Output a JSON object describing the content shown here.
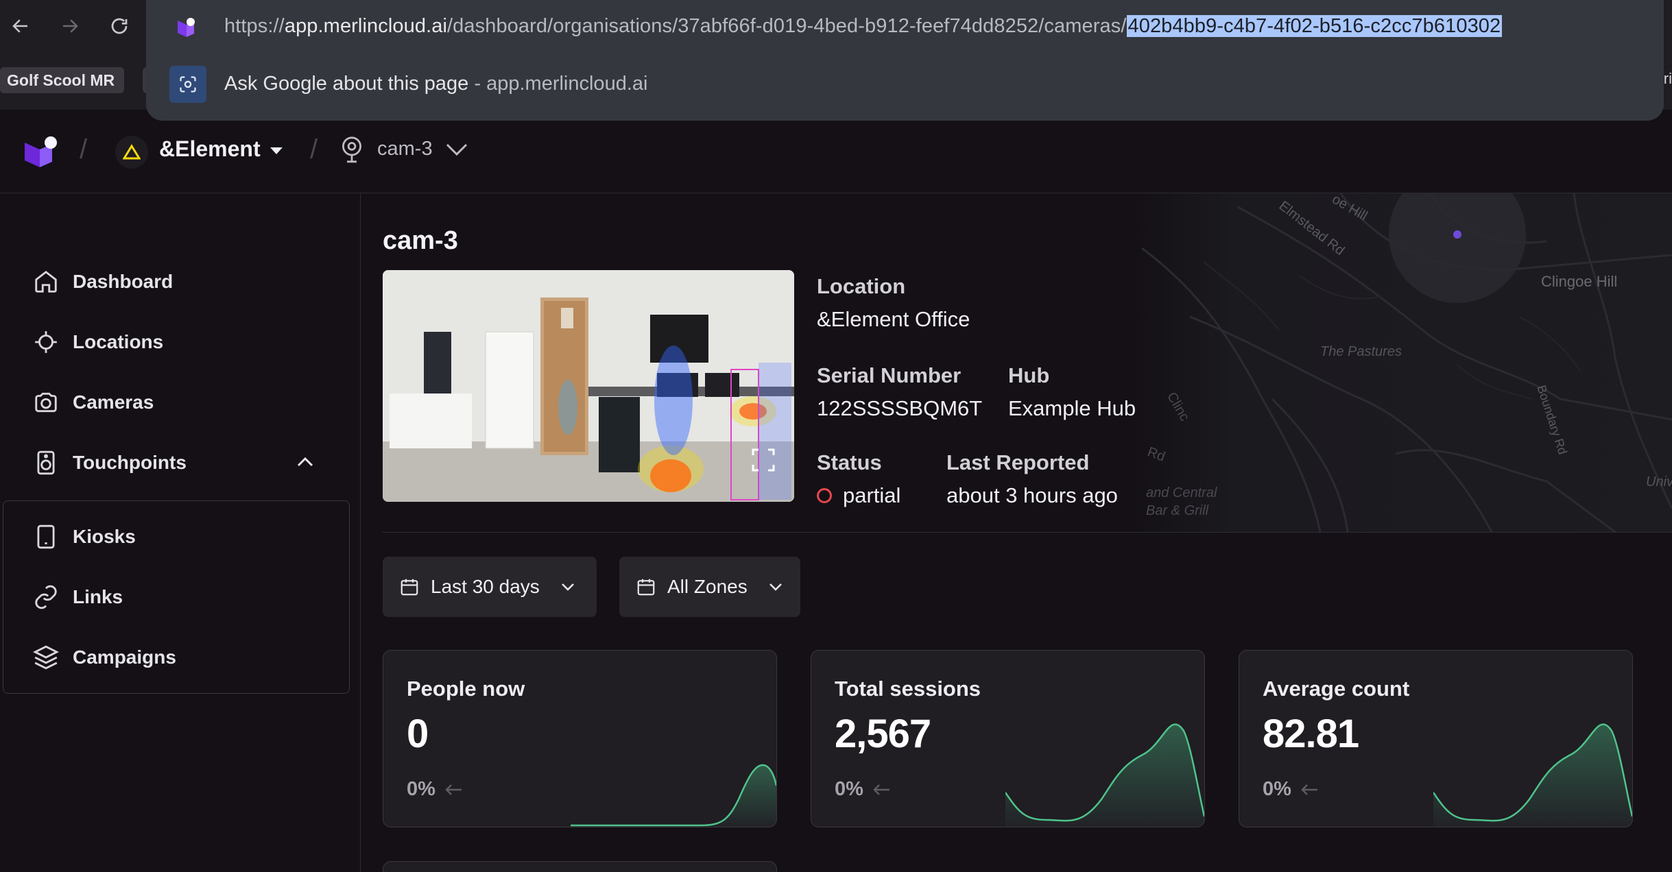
{
  "browser": {
    "url_prefix": "https://",
    "url_host": "app.merlincloud.ai",
    "url_path": "/dashboard/organisations/37abf66f-d019-4bed-b912-feef74dd8252/cameras/",
    "url_selected": "402b4bb9-c4b7-4f02-b516-c2cc7b610302",
    "ask_label": "Ask Google about this page",
    "ask_sep": " - ",
    "ask_host": "app.merlincloud.ai",
    "bookmark_label": "Golf Scool MR",
    "edge_text": "ri"
  },
  "header": {
    "org_name": "&Element",
    "camera_name": "cam-3"
  },
  "sidebar": {
    "items": [
      {
        "label": "Dashboard",
        "icon": "home-icon"
      },
      {
        "label": "Locations",
        "icon": "crosshair-icon"
      },
      {
        "label": "Cameras",
        "icon": "camera-icon"
      },
      {
        "label": "Touchpoints",
        "icon": "speaker-icon"
      }
    ],
    "sub_items": [
      {
        "label": "Kiosks",
        "icon": "tablet-icon"
      },
      {
        "label": "Links",
        "icon": "link-icon"
      },
      {
        "label": "Campaigns",
        "icon": "layers-icon"
      }
    ]
  },
  "camera": {
    "title": "cam-3",
    "location_label": "Location",
    "location_value": "&Element Office",
    "serial_label": "Serial Number",
    "serial_value": "122SSSSBQM6T",
    "hub_label": "Hub",
    "hub_value": "Example Hub",
    "status_label": "Status",
    "status_value": "partial",
    "reported_label": "Last Reported",
    "reported_value": "about 3 hours ago"
  },
  "map_labels": [
    "Elmstead Rd",
    "oe Hill",
    "Clingoe Hill",
    "The Pastures",
    "Boundary Rd",
    "Univ",
    "and Central",
    "Bar & Grill",
    "Rd",
    "Clinc"
  ],
  "filters": {
    "date_range": "Last 30 days",
    "zones": "All Zones"
  },
  "stats": [
    {
      "title": "People now",
      "value": "0",
      "delta": "0%"
    },
    {
      "title": "Total sessions",
      "value": "2,567",
      "delta": "0%"
    },
    {
      "title": "Average count",
      "value": "82.81",
      "delta": "0%"
    }
  ],
  "colors": {
    "background": "#141016",
    "card": "#201d23",
    "accent_green": "#4fc38b",
    "status_red": "#e5484d",
    "brand_purple": "#7c3aed",
    "url_highlight": "#a9c7fb"
  }
}
